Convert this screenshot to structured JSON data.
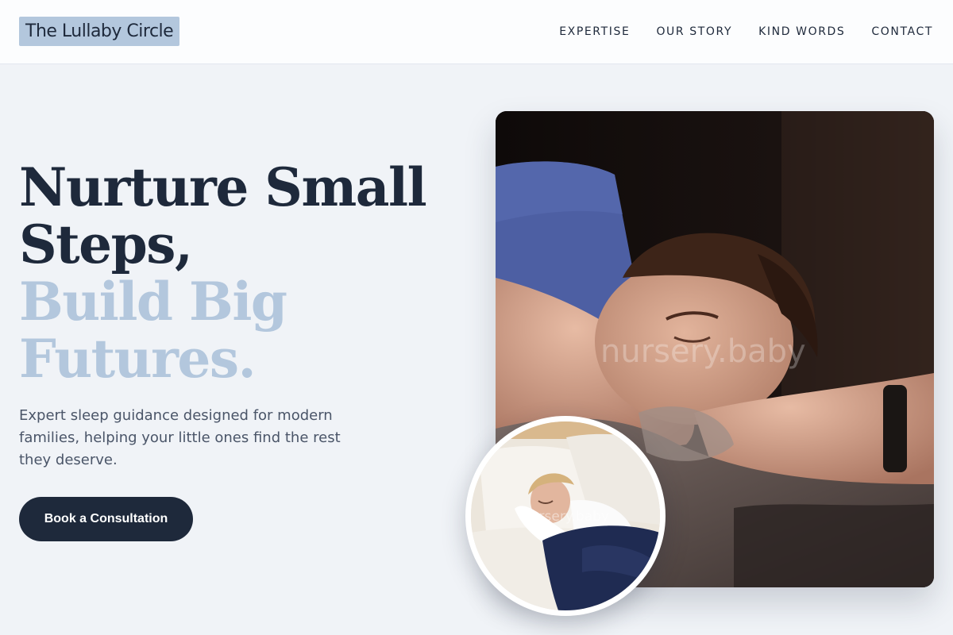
{
  "header": {
    "logo": "The Lullaby Circle",
    "nav": [
      "EXPERTISE",
      "OUR STORY",
      "KIND WORDS",
      "CONTACT"
    ]
  },
  "hero": {
    "headline_dark": [
      "Nurture Small",
      "Steps,"
    ],
    "headline_light": [
      "Build Big",
      "Futures."
    ],
    "subtext": "Expert sleep guidance designed for modern families, helping your little ones find the rest they deserve.",
    "cta_label": "Book a Consultation"
  },
  "images": {
    "main_watermark": "nursery.baby",
    "inset_watermark": "nursery.baby"
  },
  "colors": {
    "primary": "#1e293b",
    "accent": "#b3c7dd",
    "background": "#f0f3f7"
  }
}
